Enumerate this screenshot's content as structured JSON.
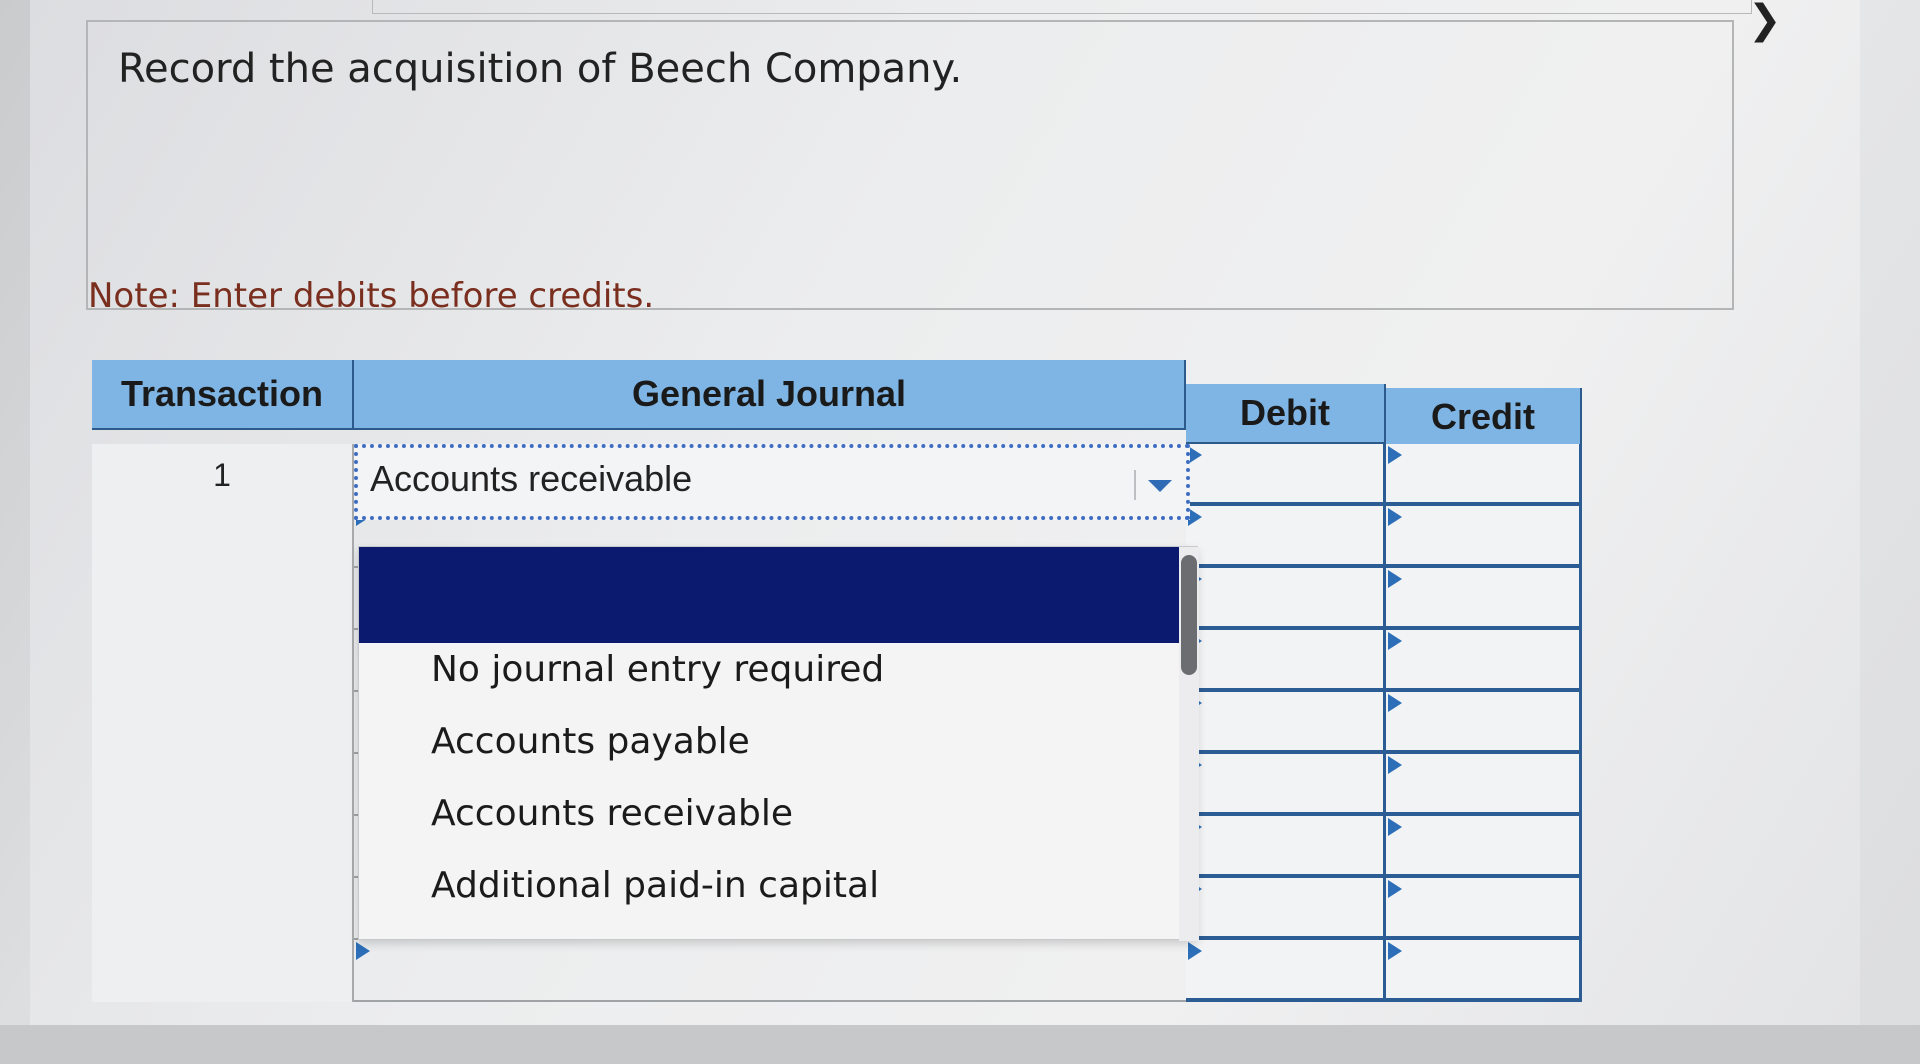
{
  "question": {
    "prompt": "Record the acquisition of Beech Company."
  },
  "note": "Note: Enter debits before credits.",
  "journal": {
    "headers": {
      "transaction": "Transaction",
      "general_journal": "General Journal",
      "debit": "Debit",
      "credit": "Credit"
    },
    "rows": [
      {
        "transaction": "1",
        "account": "Accounts receivable"
      },
      {
        "transaction": "",
        "account": ""
      },
      {
        "transaction": "",
        "account": ""
      },
      {
        "transaction": "",
        "account": ""
      },
      {
        "transaction": "",
        "account": ""
      },
      {
        "transaction": "",
        "account": ""
      },
      {
        "transaction": "",
        "account": ""
      },
      {
        "transaction": "",
        "account": ""
      },
      {
        "transaction": "",
        "account": ""
      }
    ]
  },
  "dropdown": {
    "selected_value": "Accounts receivable",
    "options": [
      "No journal entry required",
      "Accounts payable",
      "Accounts receivable",
      "Additional paid-in capital"
    ]
  },
  "icons": {
    "next": "chevron-right-icon",
    "dropdown_caret": "caret-down-icon"
  },
  "colors": {
    "header_bg": "#7fb5e4",
    "grid_line": "#2c5c94",
    "dropdown_highlight": "#0b1a6e",
    "note_text": "#7a2e1e"
  }
}
